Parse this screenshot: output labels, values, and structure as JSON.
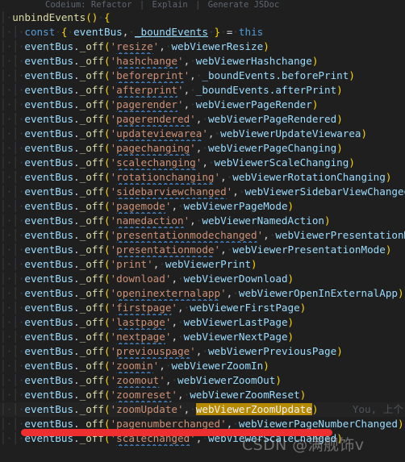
{
  "editor": {
    "theme": "dark",
    "background": "#1f1f1f",
    "current_line_background": "#232323",
    "font_size_px": 12.6,
    "line_height_px": 18
  },
  "codelens": {
    "prefix": "Codeium:",
    "actions": [
      "Refactor",
      "Explain",
      "Generate JSDoc"
    ],
    "separator": "|",
    "full_text": "Codeium: Refactor | Explain | Generate JSDoc"
  },
  "blame": {
    "text": "You, 上个"
  },
  "watermark": {
    "text": "CSDN @满舰饰v"
  },
  "annotation": {
    "type": "red-underline-stroke",
    "color": "#ef2f2f"
  },
  "highlight": {
    "token": "webViewerZoomUpdate",
    "background": "#b58900",
    "foreground": "#f2f2f2"
  },
  "colors": {
    "keyword": "#569cd6",
    "variable": "#9cdcfe",
    "function": "#dcdcaa",
    "string": "#ce9178",
    "punctuation": "#d4d4d4",
    "paren_level1": "#ffd700",
    "indent_guide": "#3a3d41",
    "whitespace_dot": "#3c3f44",
    "squiggle": "#4a90d9",
    "blame_text": "#4e5359"
  },
  "code": {
    "method_name": "unbindEvents",
    "lines": [
      {
        "n": 1,
        "indent": 1,
        "kind": "signature",
        "text": "unbindEvents() {"
      },
      {
        "n": 2,
        "indent": 2,
        "kind": "destructure",
        "text": "const { eventBus, _boundEvents } = this"
      },
      {
        "n": 3,
        "indent": 2,
        "kind": "off",
        "event": "resize",
        "handler": "webViewerResize",
        "spell": true
      },
      {
        "n": 4,
        "indent": 2,
        "kind": "off",
        "event": "hashchange",
        "handler": "webViewerHashchange",
        "spell": true
      },
      {
        "n": 5,
        "indent": 2,
        "kind": "off",
        "event": "beforeprint",
        "handler": "_boundEvents.beforePrint",
        "spell": true
      },
      {
        "n": 6,
        "indent": 2,
        "kind": "off",
        "event": "afterprint",
        "handler": "_boundEvents.afterPrint",
        "spell": true
      },
      {
        "n": 7,
        "indent": 2,
        "kind": "off",
        "event": "pagerender",
        "handler": "webViewerPageRender",
        "spell": true
      },
      {
        "n": 8,
        "indent": 2,
        "kind": "off",
        "event": "pagerendered",
        "handler": "webViewerPageRendered",
        "spell": true
      },
      {
        "n": 9,
        "indent": 2,
        "kind": "off",
        "event": "updateviewarea",
        "handler": "webViewerUpdateViewarea",
        "spell": true
      },
      {
        "n": 10,
        "indent": 2,
        "kind": "off",
        "event": "pagechanging",
        "handler": "webViewerPageChanging",
        "spell": true
      },
      {
        "n": 11,
        "indent": 2,
        "kind": "off",
        "event": "scalechanging",
        "handler": "webViewerScaleChanging",
        "spell": true
      },
      {
        "n": 12,
        "indent": 2,
        "kind": "off",
        "event": "rotationchanging",
        "handler": "webViewerRotationChanging",
        "spell": true
      },
      {
        "n": 13,
        "indent": 2,
        "kind": "off",
        "event": "sidebarviewchanged",
        "handler": "webViewerSidebarViewChanged",
        "spell": true
      },
      {
        "n": 14,
        "indent": 2,
        "kind": "off",
        "event": "pagemode",
        "handler": "webViewerPageMode",
        "spell": true
      },
      {
        "n": 15,
        "indent": 2,
        "kind": "off",
        "event": "namedaction",
        "handler": "webViewerNamedAction",
        "spell": true
      },
      {
        "n": 16,
        "indent": 2,
        "kind": "off",
        "event": "presentationmodechanged",
        "handler": "webViewerPresentationModeChanged",
        "spell": true
      },
      {
        "n": 17,
        "indent": 2,
        "kind": "off",
        "event": "presentationmode",
        "handler": "webViewerPresentationMode",
        "spell": true
      },
      {
        "n": 18,
        "indent": 2,
        "kind": "off",
        "event": "print",
        "handler": "webViewerPrint",
        "spell": false
      },
      {
        "n": 19,
        "indent": 2,
        "kind": "off",
        "event": "download",
        "handler": "webViewerDownload",
        "spell": false
      },
      {
        "n": 20,
        "indent": 2,
        "kind": "off",
        "event": "openinexternalapp",
        "handler": "webViewerOpenInExternalApp",
        "spell": true
      },
      {
        "n": 21,
        "indent": 2,
        "kind": "off",
        "event": "firstpage",
        "handler": "webViewerFirstPage",
        "spell": true
      },
      {
        "n": 22,
        "indent": 2,
        "kind": "off",
        "event": "lastpage",
        "handler": "webViewerLastPage",
        "spell": true
      },
      {
        "n": 23,
        "indent": 2,
        "kind": "off",
        "event": "nextpage",
        "handler": "webViewerNextPage",
        "spell": true
      },
      {
        "n": 24,
        "indent": 2,
        "kind": "off",
        "event": "previouspage",
        "handler": "webViewerPreviousPage",
        "spell": true
      },
      {
        "n": 25,
        "indent": 2,
        "kind": "off",
        "event": "zoomin",
        "handler": "webViewerZoomIn",
        "spell": true
      },
      {
        "n": 26,
        "indent": 2,
        "kind": "off",
        "event": "zoomout",
        "handler": "webViewerZoomOut",
        "spell": true
      },
      {
        "n": 27,
        "indent": 2,
        "kind": "off",
        "event": "zoomreset",
        "handler": "webViewerZoomReset",
        "spell": true
      },
      {
        "n": 28,
        "indent": 2,
        "kind": "off",
        "event": "zoomUpdate",
        "handler": "webViewerZoomUpdate",
        "spell": false,
        "current": true,
        "highlight_handler": true,
        "blame": true
      },
      {
        "n": 29,
        "indent": 2,
        "kind": "off",
        "event": "pagenumberchanged",
        "handler": "webViewerPageNumberChanged",
        "spell": true
      },
      {
        "n": 30,
        "indent": 2,
        "kind": "off",
        "event": "scalechanged",
        "handler": "webViewerScaleChanged",
        "spell": true
      }
    ]
  }
}
